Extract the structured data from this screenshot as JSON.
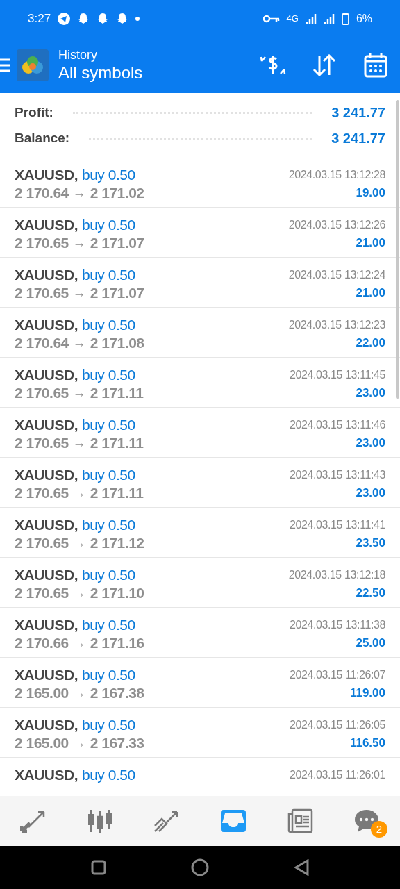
{
  "status_bar": {
    "time": "3:27",
    "network": "4G",
    "battery": "6%"
  },
  "header": {
    "subtitle": "History",
    "title": "All symbols"
  },
  "summary": [
    {
      "label": "Profit:",
      "value": "3 241.77"
    },
    {
      "label": "Balance:",
      "value": "3 241.77"
    }
  ],
  "deals": [
    {
      "symbol": "XAUUSD,",
      "side": "buy 0.50",
      "open": "2 170.64",
      "arrow": "→",
      "close": "2 171.02",
      "time": "2024.03.15 13:12:28",
      "profit": "19.00"
    },
    {
      "symbol": "XAUUSD,",
      "side": "buy 0.50",
      "open": "2 170.65",
      "arrow": "→",
      "close": "2 171.07",
      "time": "2024.03.15 13:12:26",
      "profit": "21.00"
    },
    {
      "symbol": "XAUUSD,",
      "side": "buy 0.50",
      "open": "2 170.65",
      "arrow": "→",
      "close": "2 171.07",
      "time": "2024.03.15 13:12:24",
      "profit": "21.00"
    },
    {
      "symbol": "XAUUSD,",
      "side": "buy 0.50",
      "open": "2 170.64",
      "arrow": "→",
      "close": "2 171.08",
      "time": "2024.03.15 13:12:23",
      "profit": "22.00"
    },
    {
      "symbol": "XAUUSD,",
      "side": "buy 0.50",
      "open": "2 170.65",
      "arrow": "→",
      "close": "2 171.11",
      "time": "2024.03.15 13:11:45",
      "profit": "23.00"
    },
    {
      "symbol": "XAUUSD,",
      "side": "buy 0.50",
      "open": "2 170.65",
      "arrow": "→",
      "close": "2 171.11",
      "time": "2024.03.15 13:11:46",
      "profit": "23.00"
    },
    {
      "symbol": "XAUUSD,",
      "side": "buy 0.50",
      "open": "2 170.65",
      "arrow": "→",
      "close": "2 171.11",
      "time": "2024.03.15 13:11:43",
      "profit": "23.00"
    },
    {
      "symbol": "XAUUSD,",
      "side": "buy 0.50",
      "open": "2 170.65",
      "arrow": "→",
      "close": "2 171.12",
      "time": "2024.03.15 13:11:41",
      "profit": "23.50"
    },
    {
      "symbol": "XAUUSD,",
      "side": "buy 0.50",
      "open": "2 170.65",
      "arrow": "→",
      "close": "2 171.10",
      "time": "2024.03.15 13:12:18",
      "profit": "22.50"
    },
    {
      "symbol": "XAUUSD,",
      "side": "buy 0.50",
      "open": "2 170.66",
      "arrow": "→",
      "close": "2 171.16",
      "time": "2024.03.15 13:11:38",
      "profit": "25.00"
    },
    {
      "symbol": "XAUUSD,",
      "side": "buy 0.50",
      "open": "2 165.00",
      "arrow": "→",
      "close": "2 167.38",
      "time": "2024.03.15 11:26:07",
      "profit": "119.00"
    },
    {
      "symbol": "XAUUSD,",
      "side": "buy 0.50",
      "open": "2 165.00",
      "arrow": "→",
      "close": "2 167.33",
      "time": "2024.03.15 11:26:05",
      "profit": "116.50"
    },
    {
      "symbol": "XAUUSD,",
      "side": "buy 0.50",
      "time": "2024.03.15 11:26:01"
    }
  ],
  "bottom_nav": [
    {
      "kind": "quotes",
      "selected": false
    },
    {
      "kind": "chart",
      "selected": false
    },
    {
      "kind": "trade",
      "selected": false
    },
    {
      "kind": "history",
      "selected": true
    },
    {
      "kind": "news",
      "selected": false
    },
    {
      "kind": "chat",
      "selected": false,
      "badge": "2"
    }
  ]
}
